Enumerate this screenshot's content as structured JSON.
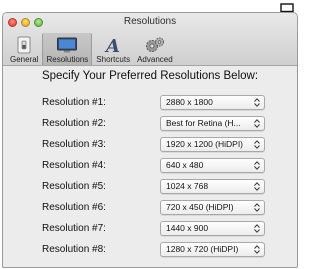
{
  "window": {
    "title": "Resolutions"
  },
  "toolbar": {
    "tabs": [
      {
        "label": "General",
        "icon": "general-switch-icon"
      },
      {
        "label": "Resolutions",
        "icon": "display-icon",
        "selected": true
      },
      {
        "label": "Shortcuts",
        "icon": "letter-a-icon"
      },
      {
        "label": "Advanced",
        "icon": "gears-icon"
      }
    ]
  },
  "main": {
    "heading": "Specify Your Preferred Resolutions Below:",
    "rows": [
      {
        "label": "Resolution #1:",
        "value": "2880 x 1800"
      },
      {
        "label": "Resolution #2:",
        "value": "Best for Retina (H..."
      },
      {
        "label": "Resolution #3:",
        "value": "1920 x 1200 (HiDPI)"
      },
      {
        "label": "Resolution #4:",
        "value": "640 x 480"
      },
      {
        "label": "Resolution #5:",
        "value": "1024 x 768"
      },
      {
        "label": "Resolution #6:",
        "value": "720 x 450 (HiDPI)"
      },
      {
        "label": "Resolution #7:",
        "value": "1440 x 900"
      },
      {
        "label": "Resolution #8:",
        "value": "1280 x 720 (HiDPI)"
      }
    ]
  },
  "colors": {
    "close": "#d9392b",
    "minimize": "#d9a21c",
    "zoom": "#5fae3a"
  }
}
